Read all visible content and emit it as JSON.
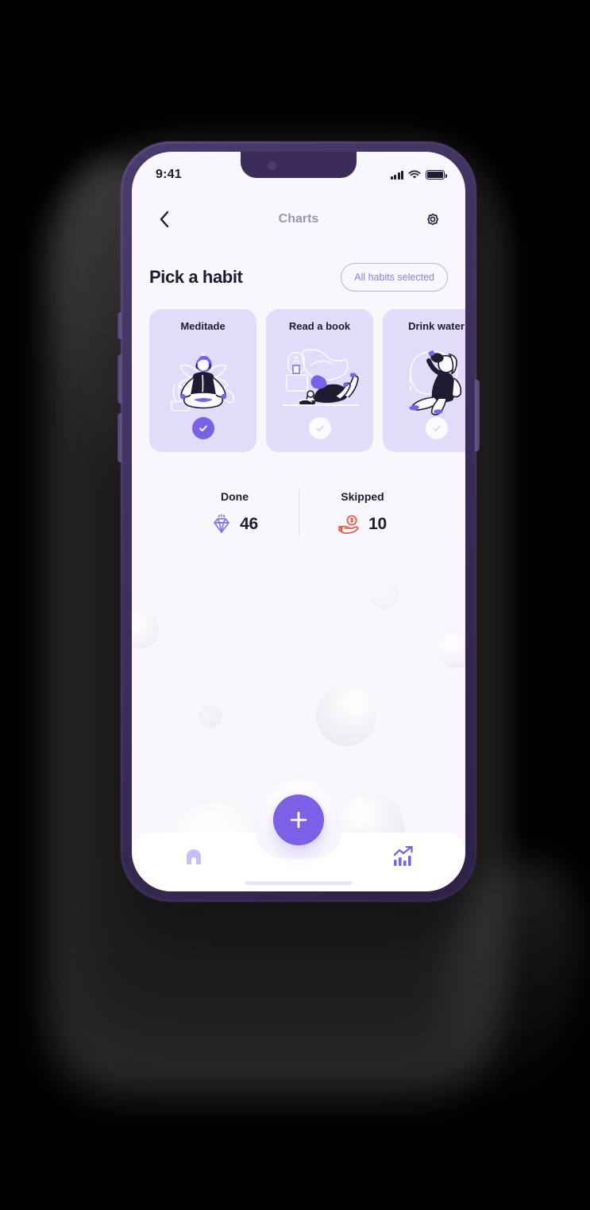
{
  "status_bar": {
    "time": "9:41",
    "signal_icon": "cellular-signal-icon",
    "wifi_icon": "wifi-icon",
    "battery_icon": "battery-full-icon"
  },
  "header": {
    "back_icon": "chevron-left-icon",
    "title": "Charts",
    "settings_icon": "gear-icon"
  },
  "main": {
    "section_title": "Pick a habit",
    "filter_pill_label": "All habits selected",
    "habits": [
      {
        "label": "Meditade",
        "selected": true,
        "art": "meditation-illustration",
        "check_icon": "check-icon"
      },
      {
        "label": "Read a book",
        "selected": false,
        "art": "reading-illustration",
        "check_icon": "check-icon"
      },
      {
        "label": "Drink water",
        "selected": false,
        "art": "drink-water-illustration",
        "check_icon": "check-icon"
      }
    ],
    "stats": [
      {
        "label": "Done",
        "value": "46",
        "icon": "diamond-icon"
      },
      {
        "label": "Skipped",
        "value": "10",
        "icon": "hand-coin-icon"
      }
    ]
  },
  "tabbar": {
    "home_icon": "home-icon",
    "add_icon": "plus-icon",
    "charts_icon": "chart-trending-up-icon"
  },
  "colors": {
    "accent": "#7B61E8",
    "accent_light": "#B9AEF5",
    "card_bg": "#E2DCFB",
    "screen_bg": "#F8F7FC",
    "text_dark": "#1E1B33",
    "text_muted": "#9B93AE",
    "skipped": "#E35D4F",
    "frame": "#453663"
  }
}
